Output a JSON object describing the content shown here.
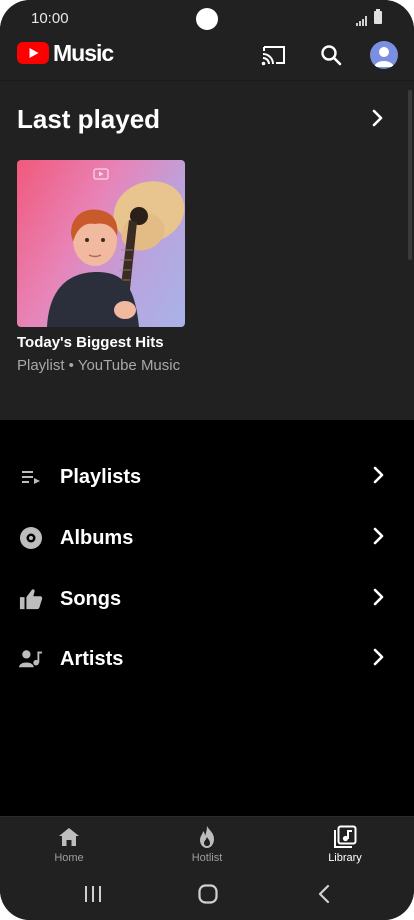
{
  "status": {
    "time": "10:00"
  },
  "app": {
    "name": "Music"
  },
  "last_played": {
    "title": "Last played",
    "card": {
      "title": "Today's Biggest Hits",
      "subtitle": "Playlist • YouTube Music"
    }
  },
  "library": {
    "items": [
      {
        "label": "Playlists",
        "icon": "playlist-icon"
      },
      {
        "label": "Albums",
        "icon": "album-icon"
      },
      {
        "label": "Songs",
        "icon": "thumb-up-icon"
      },
      {
        "label": "Artists",
        "icon": "artist-icon"
      }
    ]
  },
  "bottom_nav": {
    "items": [
      {
        "label": "Home",
        "icon": "home-icon",
        "active": false
      },
      {
        "label": "Hotlist",
        "icon": "flame-icon",
        "active": false
      },
      {
        "label": "Library",
        "icon": "library-icon",
        "active": true
      }
    ]
  },
  "colors": {
    "accent_red": "#ff0000",
    "avatar": "#7b8fe0",
    "background": "#212121"
  }
}
